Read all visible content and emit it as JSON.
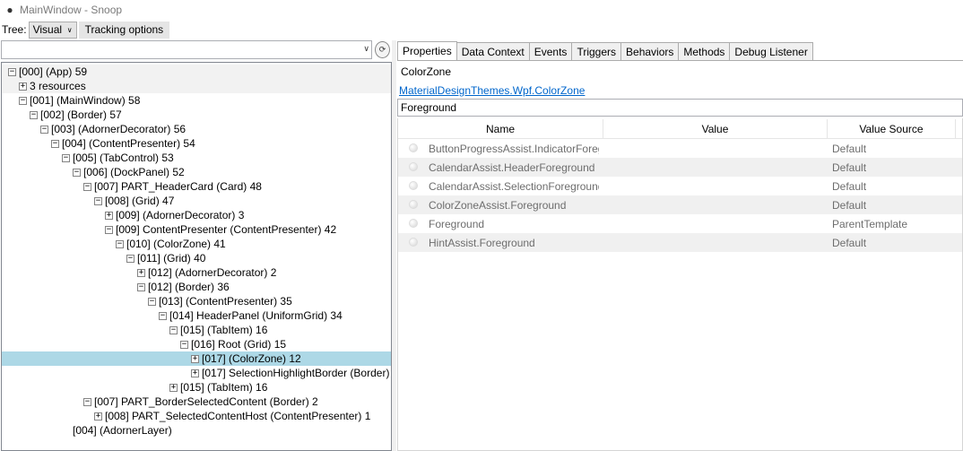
{
  "window": {
    "title": "MainWindow - Snoop"
  },
  "toolbar": {
    "tree_label": "Tree:",
    "tree_mode": "Visual",
    "tracking_label": "Tracking options"
  },
  "filter": {
    "value": ""
  },
  "tree": [
    {
      "indent": 0,
      "toggle": "minus",
      "text": "[000]  (App) 59",
      "state": "hl"
    },
    {
      "indent": 1,
      "toggle": "plus",
      "text": "3 resources",
      "state": "hl"
    },
    {
      "indent": 1,
      "toggle": "minus",
      "text": "[001]  (MainWindow) 58",
      "state": ""
    },
    {
      "indent": 2,
      "toggle": "minus",
      "text": "[002]  (Border) 57",
      "state": ""
    },
    {
      "indent": 3,
      "toggle": "minus",
      "text": "[003]  (AdornerDecorator) 56",
      "state": ""
    },
    {
      "indent": 4,
      "toggle": "minus",
      "text": "[004]  (ContentPresenter) 54",
      "state": ""
    },
    {
      "indent": 5,
      "toggle": "minus",
      "text": "[005]  (TabControl) 53",
      "state": ""
    },
    {
      "indent": 6,
      "toggle": "minus",
      "text": "[006]  (DockPanel) 52",
      "state": ""
    },
    {
      "indent": 7,
      "toggle": "minus",
      "text": "[007] PART_HeaderCard (Card) 48",
      "state": ""
    },
    {
      "indent": 8,
      "toggle": "minus",
      "text": "[008]  (Grid) 47",
      "state": ""
    },
    {
      "indent": 9,
      "toggle": "plus",
      "text": "[009]  (AdornerDecorator) 3",
      "state": ""
    },
    {
      "indent": 9,
      "toggle": "minus",
      "text": "[009] ContentPresenter (ContentPresenter) 42",
      "state": ""
    },
    {
      "indent": 10,
      "toggle": "minus",
      "text": "[010]  (ColorZone) 41",
      "state": ""
    },
    {
      "indent": 11,
      "toggle": "minus",
      "text": "[011]  (Grid) 40",
      "state": ""
    },
    {
      "indent": 12,
      "toggle": "plus",
      "text": "[012]  (AdornerDecorator) 2",
      "state": ""
    },
    {
      "indent": 12,
      "toggle": "minus",
      "text": "[012]  (Border) 36",
      "state": ""
    },
    {
      "indent": 13,
      "toggle": "minus",
      "text": "[013]  (ContentPresenter) 35",
      "state": ""
    },
    {
      "indent": 14,
      "toggle": "minus",
      "text": "[014] HeaderPanel (UniformGrid) 34",
      "state": ""
    },
    {
      "indent": 15,
      "toggle": "minus",
      "text": "[015]  (TabItem) 16",
      "state": ""
    },
    {
      "indent": 16,
      "toggle": "minus",
      "text": "[016] Root (Grid) 15",
      "state": ""
    },
    {
      "indent": 17,
      "toggle": "plus",
      "text": "[017]  (ColorZone) 12",
      "state": "sel"
    },
    {
      "indent": 17,
      "toggle": "plus",
      "text": "[017] SelectionHighlightBorder (Border) 2",
      "state": ""
    },
    {
      "indent": 15,
      "toggle": "plus",
      "text": "[015]  (TabItem) 16",
      "state": ""
    },
    {
      "indent": 7,
      "toggle": "minus",
      "text": "[007] PART_BorderSelectedContent (Border) 2",
      "state": ""
    },
    {
      "indent": 8,
      "toggle": "plus",
      "text": "[008] PART_SelectedContentHost (ContentPresenter) 1",
      "state": ""
    },
    {
      "indent": 5,
      "toggle": "none",
      "text": "[004]  (AdornerLayer)",
      "state": ""
    }
  ],
  "tabs": [
    "Properties",
    "Data Context",
    "Events",
    "Triggers",
    "Behaviors",
    "Methods",
    "Debug Listener"
  ],
  "active_tab": "Properties",
  "selected": {
    "name": "ColorZone",
    "type": "MaterialDesignThemes.Wpf.ColorZone"
  },
  "property_filter": {
    "value": "Foreground"
  },
  "grid": {
    "columns": [
      "Name",
      "Value",
      "Value Source"
    ],
    "rows": [
      {
        "name": "ButtonProgressAssist.IndicatorForeground",
        "value": "",
        "source": "Default"
      },
      {
        "name": "CalendarAssist.HeaderForeground",
        "value": "",
        "source": "Default"
      },
      {
        "name": "CalendarAssist.SelectionForeground",
        "value": "",
        "source": "Default"
      },
      {
        "name": "ColorZoneAssist.Foreground",
        "value": "",
        "source": "Default"
      },
      {
        "name": "Foreground",
        "value": "",
        "source": "ParentTemplate"
      },
      {
        "name": "HintAssist.Foreground",
        "value": "",
        "source": "Default"
      }
    ]
  },
  "colors": {
    "selected_row": "#add8e6",
    "link": "#0066cc"
  }
}
